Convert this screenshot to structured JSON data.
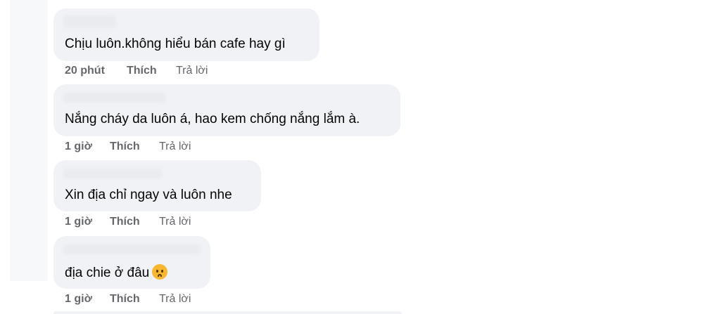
{
  "comments": [
    {
      "text": "Chịu luôn.không hiểu bán cafe hay gì",
      "time": "20 phút",
      "like": "Thích",
      "reply": "Trả lời"
    },
    {
      "text": "Nắng cháy da luôn á, hao kem chống nắng lắm à.",
      "time": "1 giờ",
      "like": "Thích",
      "reply": "Trả lời"
    },
    {
      "text": "Xin địa chỉ ngay và luôn nhe",
      "time": "1 giờ",
      "like": "Thích",
      "reply": "Trả lời"
    },
    {
      "text": "địa chie ở đâu",
      "emoji": "frowning-face-emoji",
      "time": "1 giờ",
      "like": "Thích",
      "reply": "Trả lời"
    }
  ],
  "colors": {
    "bubble": "#f0f2f5",
    "text": "#050505",
    "meta": "#65676b"
  }
}
